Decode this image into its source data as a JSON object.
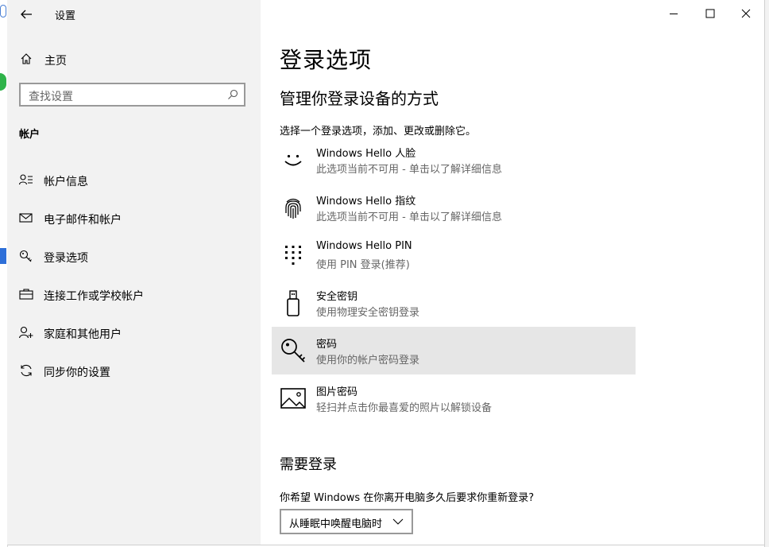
{
  "app": {
    "title": "设置"
  },
  "sidebar": {
    "home_label": "主页",
    "search_placeholder": "查找设置",
    "section": "帐户",
    "items": [
      {
        "label": "帐户信息",
        "icon": "account-info-icon"
      },
      {
        "label": "电子邮件和帐户",
        "icon": "mail-icon"
      },
      {
        "label": "登录选项",
        "icon": "key-icon"
      },
      {
        "label": "连接工作或学校帐户",
        "icon": "briefcase-icon"
      },
      {
        "label": "家庭和其他用户",
        "icon": "add-person-icon"
      },
      {
        "label": "同步你的设置",
        "icon": "sync-icon"
      }
    ]
  },
  "main": {
    "title": "登录选项",
    "subtitle": "管理你登录设备的方式",
    "description": "选择一个登录选项，添加、更改或删除它。",
    "options": [
      {
        "title": "Windows Hello 人脸",
        "subtitle": "此选项当前不可用 - 单击以了解详细信息",
        "icon": "face-icon"
      },
      {
        "title": "Windows Hello 指纹",
        "subtitle": "此选项当前不可用 - 单击以了解详细信息",
        "icon": "fingerprint-icon"
      },
      {
        "title": "Windows Hello PIN",
        "subtitle": "使用 PIN 登录(推荐)",
        "icon": "pin-keypad-icon"
      },
      {
        "title": "安全密钥",
        "subtitle": "使用物理安全密钥登录",
        "icon": "usb-key-icon"
      },
      {
        "title": "密码",
        "subtitle": "使用你的帐户密码登录",
        "icon": "password-key-icon",
        "selected": true
      },
      {
        "title": "图片密码",
        "subtitle": "轻扫并点击你最喜爱的照片以解锁设备",
        "icon": "picture-icon"
      }
    ],
    "require_signin": {
      "heading": "需要登录",
      "question": "你希望 Windows 在你离开电脑多久后要求你重新登录?",
      "dropdown_value": "从睡眠中唤醒电脑时"
    }
  },
  "colors": {
    "sidebar_bg": "#f2f2f2",
    "selected_bg": "#e6e6e6",
    "secondary_text": "#666666"
  }
}
